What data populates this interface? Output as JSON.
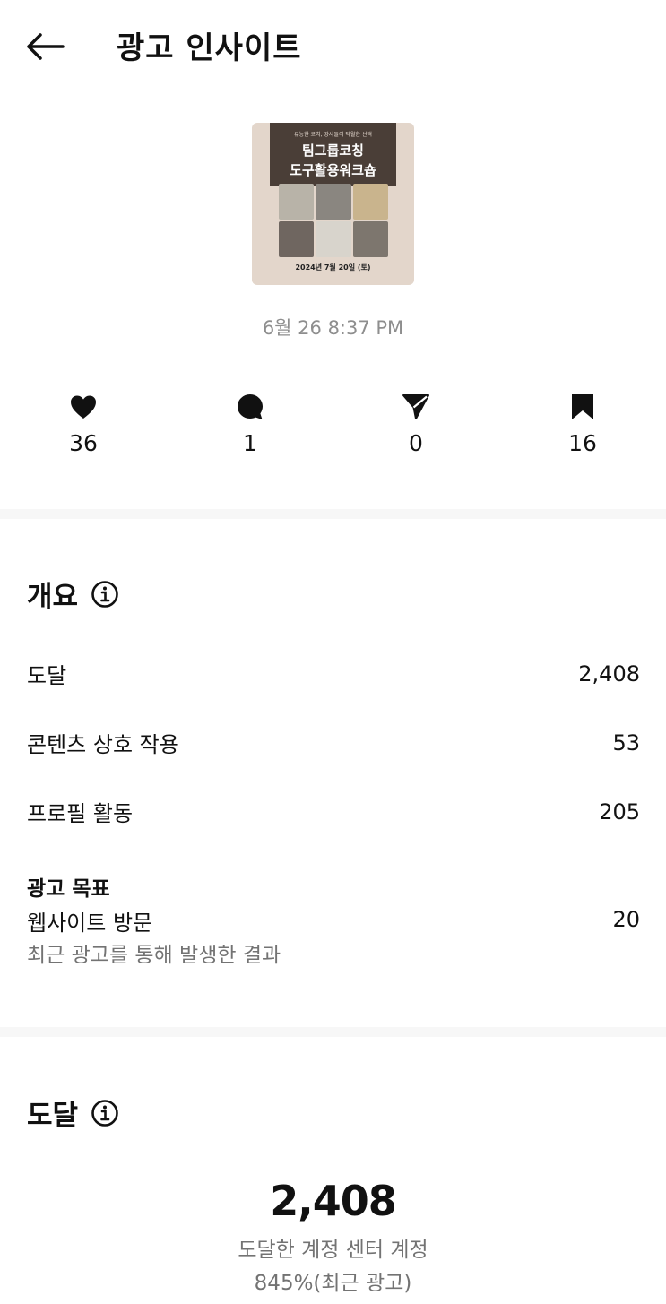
{
  "header": {
    "title": "광고 인사이트"
  },
  "post": {
    "thumbnail": {
      "subtitle": "유능한 코치, 강사들의 탁월한 선택",
      "line1": "팀그룹코칭",
      "line2": "도구활용워크숍",
      "date": "2024년 7월 20일 (토)"
    },
    "timestamp": "6월 26 8:37 PM"
  },
  "stats": {
    "likes": "36",
    "comments": "1",
    "shares": "0",
    "saves": "16"
  },
  "overview": {
    "title": "개요",
    "rows": [
      {
        "label": "도달",
        "value": "2,408"
      },
      {
        "label": "콘텐츠 상호 작용",
        "value": "53"
      },
      {
        "label": "프로필 활동",
        "value": "205"
      }
    ],
    "goal": {
      "title": "광고 목표",
      "label": "웹사이트 방문",
      "value": "20",
      "note": "최근 광고를 통해 발생한 결과"
    }
  },
  "reach": {
    "title": "도달",
    "value": "2,408",
    "label": "도달한 계정 센터 계정",
    "percent": "845%(최근 광고)"
  },
  "colors": {
    "text": "#111111",
    "muted": "#737373",
    "divider": "#f7f7f7"
  }
}
